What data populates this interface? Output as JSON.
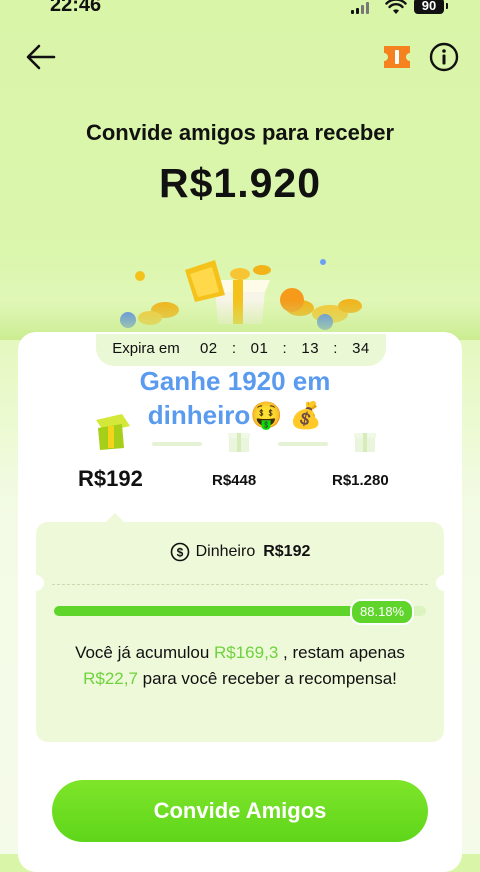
{
  "status_bar": {
    "time": "22:46",
    "battery": "90"
  },
  "header": {
    "back_icon": "arrow-left-icon",
    "ticket_icon": "ticket-icon",
    "info_icon": "info-icon"
  },
  "hero": {
    "title": "Convide amigos para receber",
    "amount": "R$1.920"
  },
  "timer": {
    "label": "Expira em",
    "days": "02",
    "hours": "01",
    "minutes": "13",
    "seconds": "34",
    "sep": ":"
  },
  "promo": {
    "line1": "Ganhe  1920 em",
    "line2": "dinheiro🤑 💰"
  },
  "stages": [
    {
      "value": "R$192",
      "active": true
    },
    {
      "value": "R$448",
      "active": false
    },
    {
      "value": "R$1.280",
      "active": false
    }
  ],
  "reward": {
    "cash_label": "Dinheiro",
    "cash_value": "R$192",
    "progress_fraction": 0.8818,
    "progress_label": "88.18%",
    "text_prefix": "Você já acumulou ",
    "accumulated": "R$169,3",
    "text_middle": " , restam apenas ",
    "remaining": "R$22,7",
    "text_suffix": " para você receber a recompensa!"
  },
  "cta": {
    "label": "Convide Amigos"
  },
  "colors": {
    "accent_green": "#5fd52b",
    "promo_blue": "#5a9bef",
    "highlight_green": "#6ed33b"
  }
}
